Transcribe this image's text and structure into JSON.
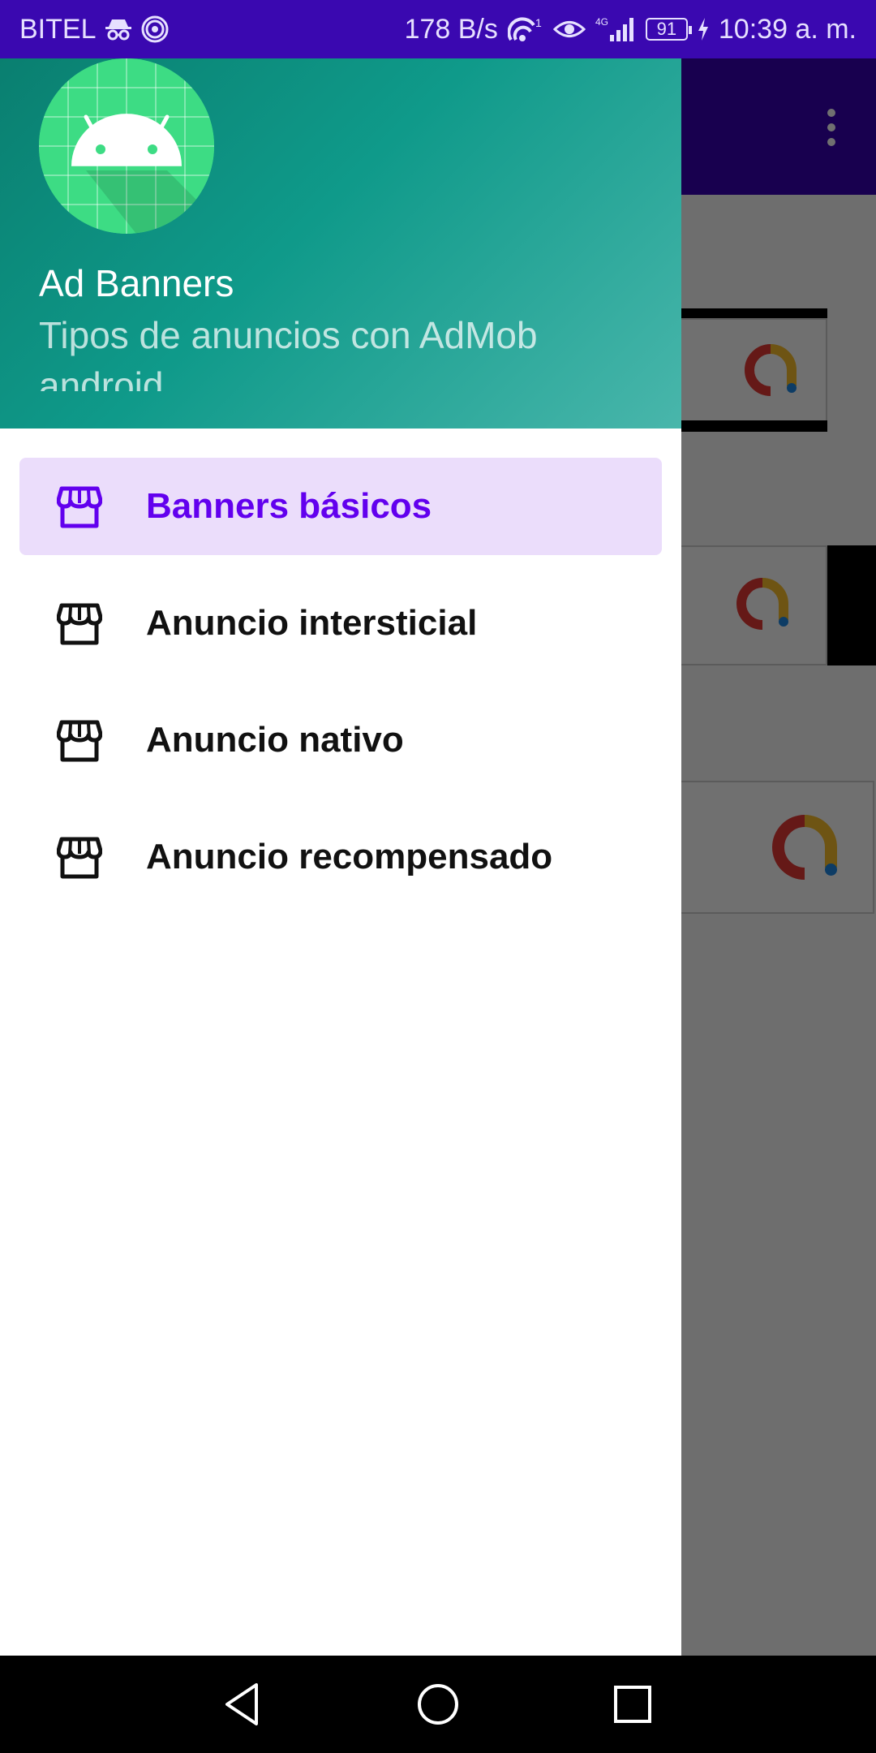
{
  "status_bar": {
    "carrier": "BITEL",
    "speed": "178 B/s",
    "hotspot_badge": "1",
    "network": "4G",
    "battery": "91",
    "time": "10:39 a. m."
  },
  "drawer": {
    "header": {
      "title": "Ad Banners",
      "subtitle": "Tipos de anuncios con AdMob android"
    },
    "items": [
      {
        "label": "Banners básicos",
        "icon": "store-icon",
        "selected": true
      },
      {
        "label": "Anuncio intersticial",
        "icon": "store-icon",
        "selected": false
      },
      {
        "label": "Anuncio nativo",
        "icon": "store-icon",
        "selected": false
      },
      {
        "label": "Anuncio recompensado",
        "icon": "store-icon",
        "selected": false
      }
    ]
  },
  "colors": {
    "status_bar": "#3a08b0",
    "toolbar": "#3700b3",
    "accent": "#6200ee",
    "selected_bg": "#ebddfb",
    "header_gradient_start": "#0a7f70",
    "header_gradient_end": "#49b6ab"
  },
  "navigation": {
    "back": "back-icon",
    "home": "home-icon",
    "recents": "recents-icon"
  }
}
